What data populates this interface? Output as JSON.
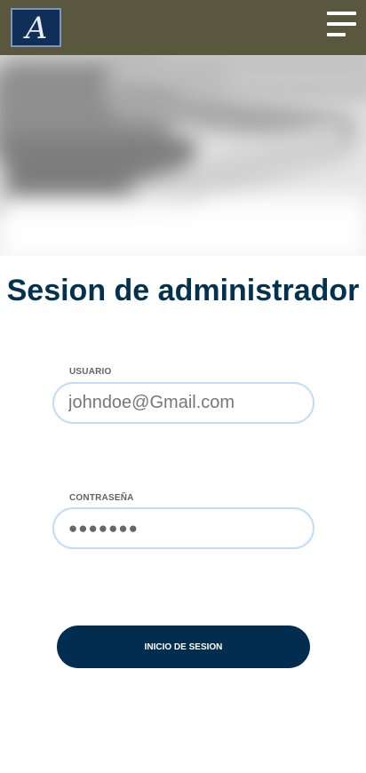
{
  "header": {
    "logo_letter": "A",
    "menu_icon": "hamburger-menu-icon",
    "background_color": "#5a573f"
  },
  "login": {
    "title": "Sesion de administrador",
    "username_label": "USUARIO",
    "username_value": "johndoe@Gmail.com",
    "password_label": "CONTRASEÑA",
    "password_value": "●●●●●●●",
    "submit_label": "INICIO DE SESION"
  },
  "colors": {
    "primary": "#032d4e",
    "input_border": "#bfdcfb",
    "logo_background": "#0f2f58"
  }
}
